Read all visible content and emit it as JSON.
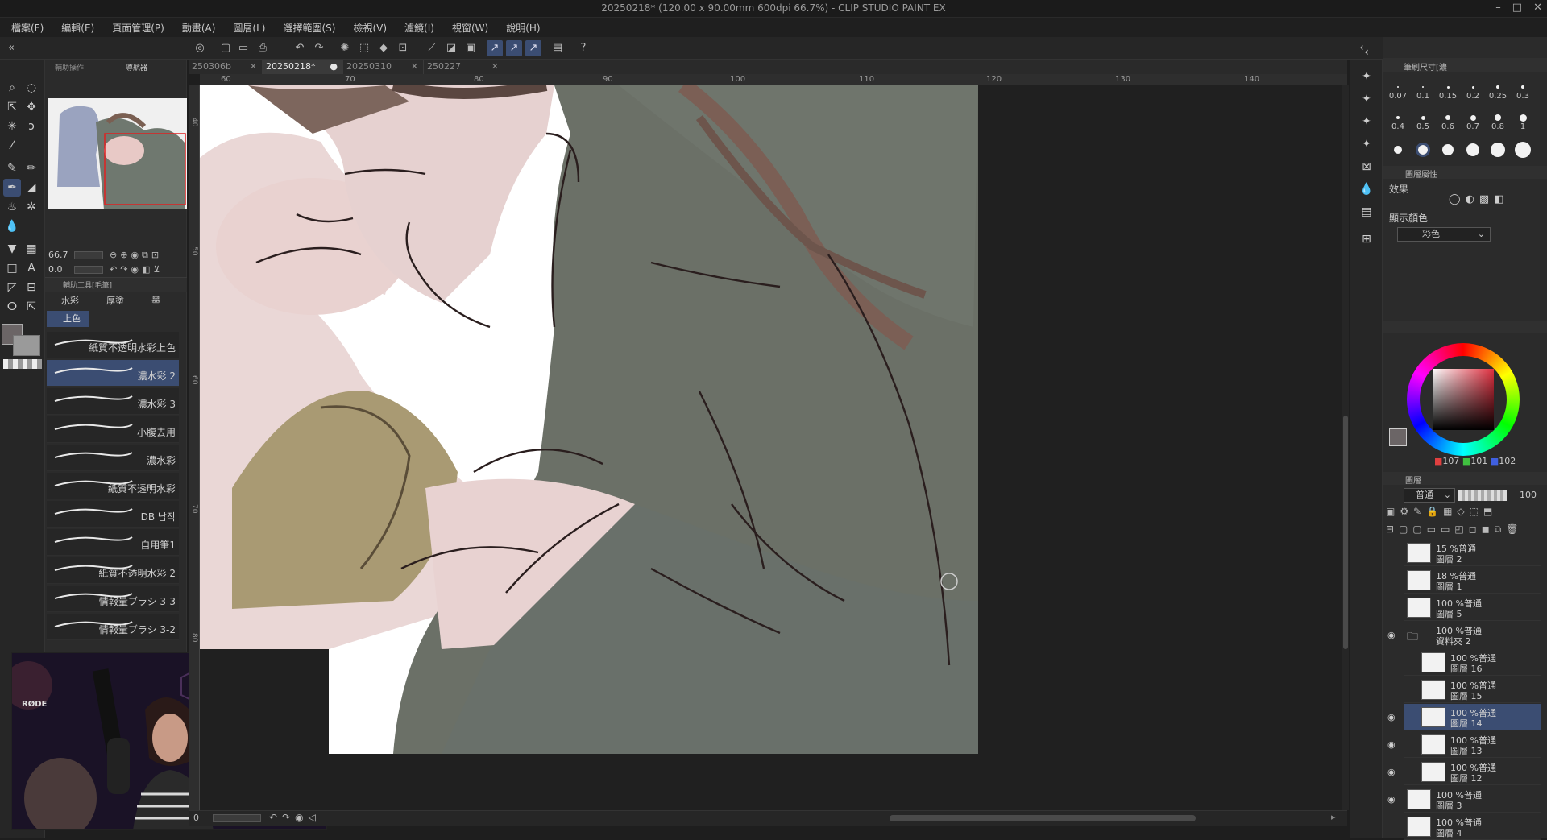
{
  "window": {
    "title": "20250218* (120.00 x 90.00mm 600dpi 66.7%)  - CLIP STUDIO PAINT EX",
    "buttons": [
      "–",
      "□",
      "✕"
    ]
  },
  "menu": [
    "檔案(F)",
    "編輯(E)",
    "頁面管理(P)",
    "動畫(A)",
    "圖層(L)",
    "選擇範圍(S)",
    "檢視(V)",
    "濾鏡(I)",
    "視窗(W)",
    "說明(H)"
  ],
  "navigator": {
    "tabs": [
      "輔助操作",
      "導航器"
    ],
    "zoom": "66.7",
    "rotation": "0.0"
  },
  "subtool": {
    "header": "輔助工具[毛筆]",
    "groups": [
      "水彩",
      "厚塗",
      "墨"
    ],
    "active_group": "上色",
    "brushes": [
      {
        "name": "紙質不透明水彩上色",
        "selected": false
      },
      {
        "name": "濃水彩 2",
        "selected": true
      },
      {
        "name": "濃水彩 3",
        "selected": false
      },
      {
        "name": "小腹去用",
        "selected": false
      },
      {
        "name": "濃水彩",
        "selected": false
      },
      {
        "name": "紙質不透明水彩",
        "selected": false
      },
      {
        "name": "DB 납작",
        "selected": false
      },
      {
        "name": "自用筆1",
        "selected": false
      },
      {
        "name": "紙質不透明水彩 2",
        "selected": false
      },
      {
        "name": "情報量ブラシ 3-3",
        "selected": false
      },
      {
        "name": "情報量ブラシ 3-2",
        "selected": false
      }
    ]
  },
  "doc_tabs": [
    {
      "label": "250306b",
      "active": false
    },
    {
      "label": "20250218*",
      "active": true
    },
    {
      "label": "20250310",
      "active": false
    },
    {
      "label": "250227",
      "active": false
    }
  ],
  "ruler": {
    "h_labels": [
      "60",
      "70",
      "80",
      "90",
      "100",
      "110",
      "120",
      "130",
      "140"
    ],
    "v_labels": [
      "40",
      "50",
      "60",
      "70",
      "80"
    ]
  },
  "status": {
    "zoom": "0"
  },
  "brush_size": {
    "title": "筆刷尺寸[濃",
    "sizes": [
      "0.07",
      "0.1",
      "0.15",
      "0.2",
      "0.25",
      "0.3",
      "0.4",
      "0.5",
      "0.6",
      "0.7",
      "0.8",
      "1"
    ]
  },
  "layer_property": {
    "title": "圖層屬性",
    "effect_label": "效果",
    "display_color_label": "顯示顏色",
    "display_color_value": "彩色"
  },
  "color_wheel": {
    "r": "107",
    "g": "101",
    "b": "102",
    "main_color": "#6b6566"
  },
  "layers_panel": {
    "title": "圖層",
    "blend_mode": "普通",
    "opacity": "100",
    "layers": [
      {
        "line1": "15 %普通",
        "line2": "圖層 2",
        "visible": false,
        "indent": 0
      },
      {
        "line1": "18 %普通",
        "line2": "圖層 1",
        "visible": false,
        "indent": 0
      },
      {
        "line1": "100 %普通",
        "line2": "圖層 5",
        "visible": false,
        "indent": 0
      },
      {
        "line1": "100 %普通",
        "line2": "資料夾 2",
        "visible": true,
        "indent": 0,
        "folder": true
      },
      {
        "line1": "100 %普通",
        "line2": "圖層 16",
        "visible": false,
        "indent": 1
      },
      {
        "line1": "100 %普通",
        "line2": "圖層 15",
        "visible": false,
        "indent": 1
      },
      {
        "line1": "100 %普通",
        "line2": "圖層 14",
        "visible": true,
        "indent": 1,
        "selected": true
      },
      {
        "line1": "100 %普通",
        "line2": "圖層 13",
        "visible": true,
        "indent": 1
      },
      {
        "line1": "100 %普通",
        "line2": "圖層 12",
        "visible": true,
        "indent": 1
      },
      {
        "line1": "100 %普通",
        "line2": "圖層 3",
        "visible": true,
        "indent": 0
      },
      {
        "line1": "100 %普通",
        "line2": "圖層 4",
        "visible": false,
        "indent": 0
      }
    ]
  },
  "webcam": {
    "mic_brand": "RØDE"
  }
}
